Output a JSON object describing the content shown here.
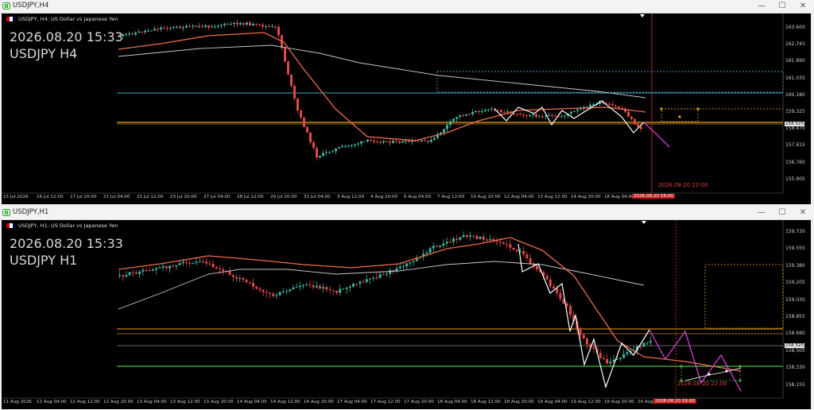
{
  "windows": [
    {
      "title": "USDJPY,H4",
      "info_line": "USDJPY, H4:  US Dollar vs Japanese Yen",
      "big_time": "2026.08.20 15:33",
      "big_symbol": "USDJPY H4",
      "price_axis": [
        "163.600",
        "162.745",
        "161.890",
        "161.035",
        "160.180",
        "159.325",
        "158.470",
        "157.615",
        "156.760",
        "155.905"
      ],
      "current_price": "158.525",
      "time_axis": [
        "15 Jul 2026",
        "16 Jul 12:00",
        "17 Jul 20:00",
        "21 Jul 04:00",
        "22 Jul 12:00",
        "23 Jul 20:00",
        "27 Jul 04:00",
        "28 Jul 12:00",
        "29 Jul 20:00",
        "31 Jul 04:00",
        "3 Aug 12:00",
        "4 Aug 20:00",
        "6 Aug 04:00",
        "7 Aug 12:00",
        "10 Aug 20:00",
        "12 Aug 04:00",
        "13 Aug 12:00",
        "14 Aug 20:00",
        "18 Aug 04:00",
        "19"
      ],
      "current_time_label": "2026.08.20 16:00",
      "vline_label": "2026.08.20 22:00"
    },
    {
      "title": "USDJPY,H1",
      "info_line": "USDJPY, H1:  US Dollar vs Japanese Yen",
      "big_time": "2026.08.20 15:33",
      "big_symbol": "USDJPY H1",
      "price_axis": [
        "159.730",
        "159.555",
        "159.380",
        "159.205",
        "159.030",
        "158.855",
        "158.680",
        "158.505",
        "158.330",
        "158.155"
      ],
      "current_price": "158.525",
      "time_axis": [
        "11 Aug 2026",
        "12 Aug 04:00",
        "12 Aug 12:00",
        "12 Aug 20:00",
        "13 Aug 04:00",
        "13 Aug 12:00",
        "13 Aug 20:00",
        "14 Aug 04:00",
        "14 Aug 12:00",
        "14 Aug 20:00",
        "17 Aug 04:00",
        "17 Aug 12:00",
        "17 Aug 20:00",
        "18 Aug 04:00",
        "18 Aug 12:00",
        "18 Aug 20:00",
        "19 Aug 04:00",
        "19 Aug 12:00",
        "19 Aug 20:00",
        "20 Aug 04:00"
      ],
      "current_time_label": "2026.08.20 16:00",
      "vline_label": "2026.08.20 22:00"
    }
  ],
  "window_buttons": {
    "minimize": "—",
    "maximize": "☐",
    "close": "✕"
  },
  "colors": {
    "bull": "#3fb3a0",
    "bear": "#e04848",
    "fast_ma": "#f06a50",
    "slow_ma": "#c8c8c8",
    "zigzag": "#ffffff",
    "forecast": "#d040d0",
    "orange": "#e8a020",
    "green": "#3ec03e",
    "cyan_level": "#4aa0c0"
  }
}
